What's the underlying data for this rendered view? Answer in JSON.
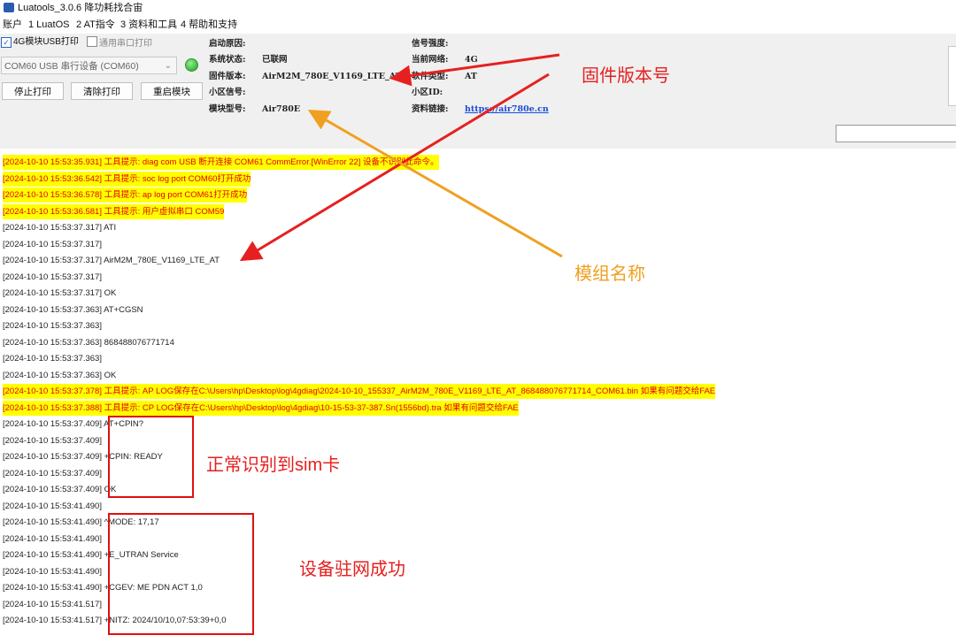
{
  "window": {
    "title": "Luatools_3.0.6 降功耗找合宙"
  },
  "menu": [
    "账户",
    "1 LuatOS",
    "2 AT指令",
    "3 资料和工具",
    "4 帮助和支持"
  ],
  "options": {
    "usb_print_label": "4G模块USB打印",
    "serial_print_label": "通用串口打印",
    "com_selected": "COM60 USB 串行设备 (COM60)"
  },
  "buttons": {
    "stop_print": "停止打印",
    "clear_print": "清除打印",
    "restart_module": "重启模块"
  },
  "info": {
    "boot_reason_label": "启动原因:",
    "system_status_label": "系统状态:",
    "system_status_value": "已联网",
    "firmware_version_label": "固件版本:",
    "firmware_version_value": "AirM2M_780E_V1169_LTE_AT",
    "cell_signal_label": "小区信号:",
    "module_model_label": "模块型号:",
    "module_model_value": "Air780E",
    "signal_strength_label": "信号强度:",
    "current_network_label": "当前网络:",
    "current_network_value": "4G",
    "software_type_label": "软件类型:",
    "software_type_value": "AT",
    "cell_id_label": "小区ID:",
    "docs_link_label": "资料链接:",
    "docs_link_value": "https://air780e.cn"
  },
  "log_lines": [
    {
      "text": "[2024-10-10 15:53:35.931] 工具提示: diag com USB 断开连接 COM61 CommError.[WinError 22] 设备不识别此命令。",
      "highlight": true
    },
    {
      "text": "[2024-10-10 15:53:36.542] 工具提示: soc log port COM60打开成功",
      "highlight": true
    },
    {
      "text": "[2024-10-10 15:53:36.578] 工具提示: ap log port COM61打开成功",
      "highlight": true
    },
    {
      "text": "[2024-10-10 15:53:36.581] 工具提示: 用户虚拟串口 COM59",
      "highlight": true
    },
    {
      "text": "[2024-10-10 15:53:37.317] ATI",
      "highlight": false
    },
    {
      "text": "[2024-10-10 15:53:37.317]",
      "highlight": false
    },
    {
      "text": "[2024-10-10 15:53:37.317] AirM2M_780E_V1169_LTE_AT",
      "highlight": false
    },
    {
      "text": "[2024-10-10 15:53:37.317]",
      "highlight": false
    },
    {
      "text": "[2024-10-10 15:53:37.317] OK",
      "highlight": false
    },
    {
      "text": "[2024-10-10 15:53:37.363] AT+CGSN",
      "highlight": false
    },
    {
      "text": "[2024-10-10 15:53:37.363]",
      "highlight": false
    },
    {
      "text": "[2024-10-10 15:53:37.363] 868488076771714",
      "highlight": false
    },
    {
      "text": "[2024-10-10 15:53:37.363]",
      "highlight": false
    },
    {
      "text": "[2024-10-10 15:53:37.363] OK",
      "highlight": false
    },
    {
      "text": "[2024-10-10 15:53:37.378] 工具提示: AP LOG保存在C:\\Users\\hp\\Desktop\\log\\4gdiag\\2024-10-10_155337_AirM2M_780E_V1169_LTE_AT_868488076771714_COM61.bin 如果有问题交给FAE",
      "highlight": true
    },
    {
      "text": "[2024-10-10 15:53:37.388] 工具提示: CP LOG保存在C:\\Users\\hp\\Desktop\\log\\4gdiag\\10-15-53-37-387.Sn(1556bd).tra 如果有问题交给FAE",
      "highlight": true
    },
    {
      "text": "[2024-10-10 15:53:37.409] AT+CPIN?",
      "highlight": false
    },
    {
      "text": "[2024-10-10 15:53:37.409]",
      "highlight": false
    },
    {
      "text": "[2024-10-10 15:53:37.409] +CPIN: READY",
      "highlight": false
    },
    {
      "text": "[2024-10-10 15:53:37.409]",
      "highlight": false
    },
    {
      "text": "[2024-10-10 15:53:37.409] OK",
      "highlight": false
    },
    {
      "text": "[2024-10-10 15:53:41.490]",
      "highlight": false
    },
    {
      "text": "[2024-10-10 15:53:41.490] ^MODE: 17,17",
      "highlight": false
    },
    {
      "text": "[2024-10-10 15:53:41.490]",
      "highlight": false
    },
    {
      "text": "[2024-10-10 15:53:41.490] +E_UTRAN Service",
      "highlight": false
    },
    {
      "text": "[2024-10-10 15:53:41.490]",
      "highlight": false
    },
    {
      "text": "[2024-10-10 15:53:41.490] +CGEV: ME PDN ACT 1,0",
      "highlight": false
    },
    {
      "text": "[2024-10-10 15:53:41.517]",
      "highlight": false
    },
    {
      "text": "[2024-10-10 15:53:41.517] +NITZ: 2024/10/10,07:53:39+0,0",
      "highlight": false
    }
  ],
  "annotations": {
    "firmware_version": "固件版本号",
    "module_name": "模组名称",
    "sim_ok": "正常识别到sim卡",
    "network_ok": "设备驻网成功"
  },
  "colors": {
    "highlight_bg": "#ffff00",
    "highlight_text": "#e60000",
    "annotation_red": "#e62020",
    "annotation_orange": "#f0a020",
    "link": "#1a4bd6"
  }
}
